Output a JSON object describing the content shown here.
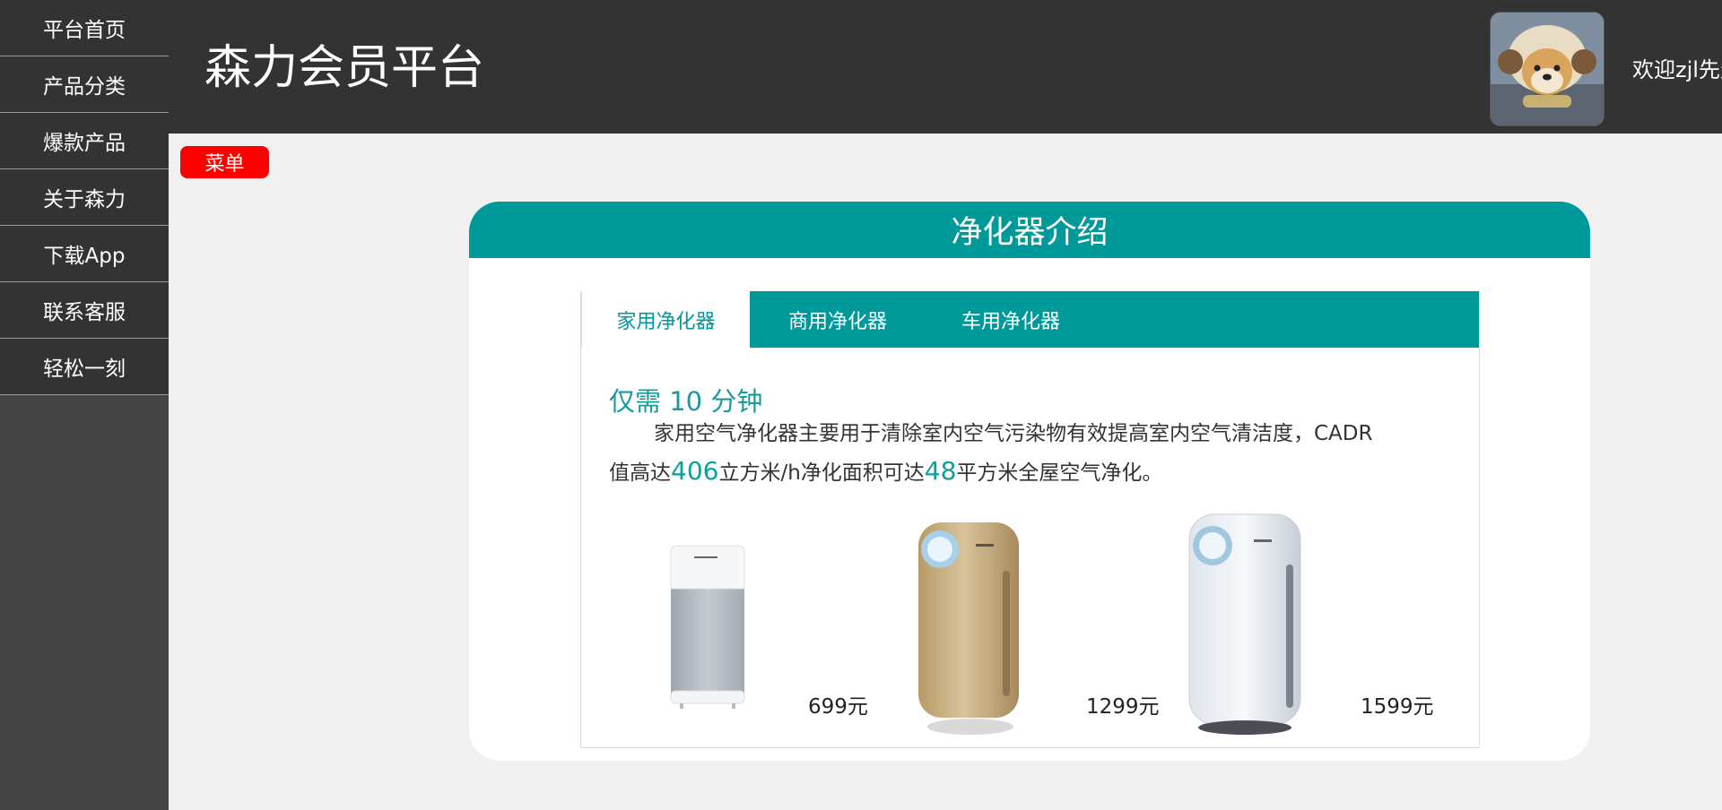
{
  "sidebar": {
    "items": [
      {
        "label": "平台首页"
      },
      {
        "label": "产品分类"
      },
      {
        "label": "爆款产品"
      },
      {
        "label": "关于森力"
      },
      {
        "label": "下载App"
      },
      {
        "label": "联系客服"
      },
      {
        "label": "轻松一刻"
      }
    ]
  },
  "header": {
    "title": "森力会员平台",
    "welcome": "欢迎zjl先生"
  },
  "menu_badge": "菜单",
  "card": {
    "title": "净化器介绍",
    "tabs": [
      {
        "label": "家用净化器",
        "active": true
      },
      {
        "label": "商用净化器",
        "active": false
      },
      {
        "label": "车用净化器",
        "active": false
      }
    ],
    "heading": "仅需 10 分钟",
    "desc": {
      "part1": "家用空气净化器主要用于清除室内空气污染物有效提高室内空气清洁度，CADR值高达",
      "num1": "406",
      "part2": "立方米/h净化面积可达",
      "num2": "48",
      "part3": "平方米全屋空气净化。"
    },
    "products": [
      {
        "price": "699元",
        "color": "white-grey"
      },
      {
        "price": "1299元",
        "color": "gold"
      },
      {
        "price": "1599元",
        "color": "white-silver"
      }
    ]
  },
  "colors": {
    "accent": "#009999",
    "menu_badge": "#ff0000",
    "header_bg": "#333333",
    "sidebar_bg": "#444444"
  }
}
